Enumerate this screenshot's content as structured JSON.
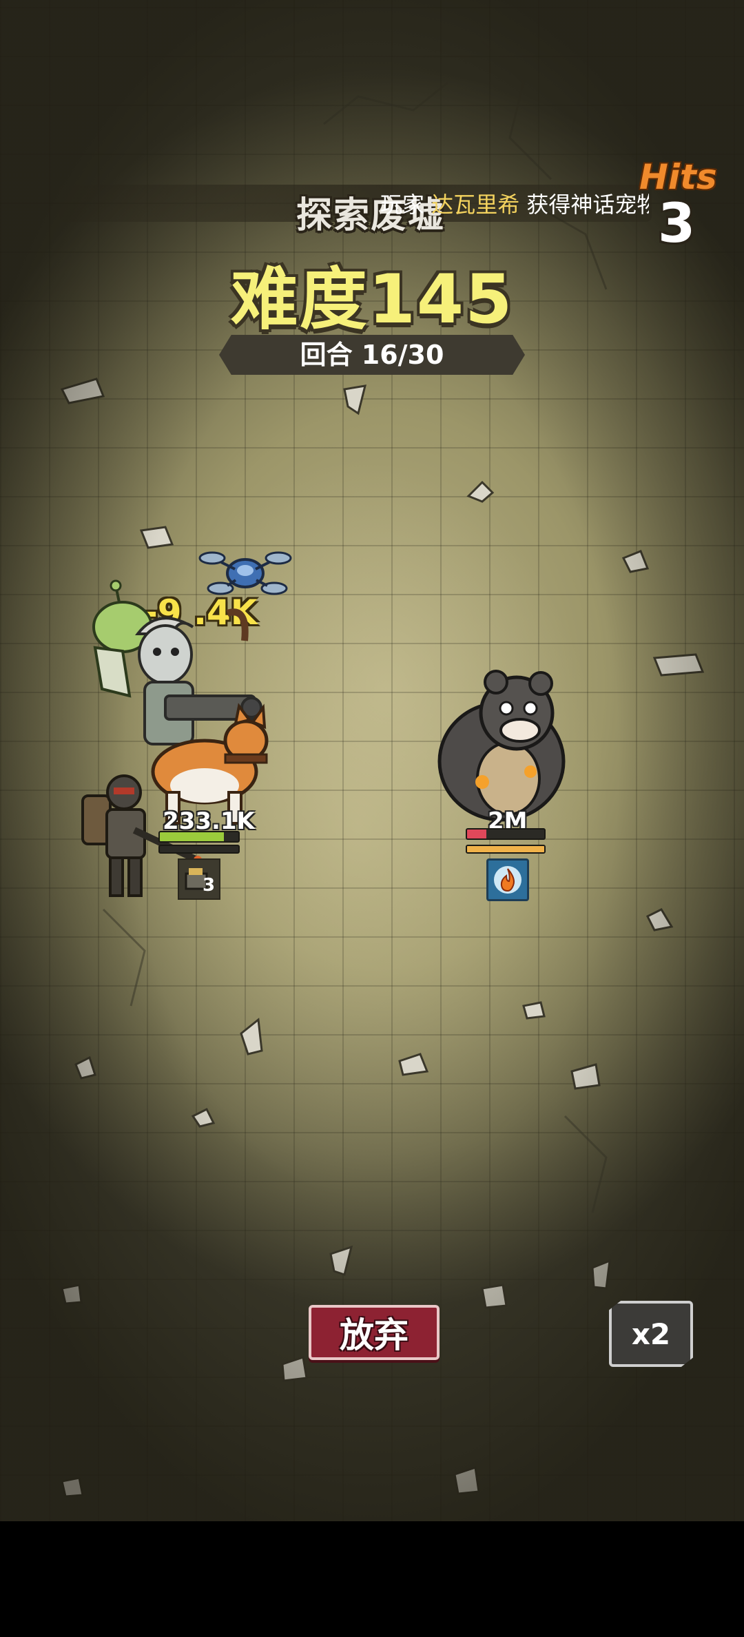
{
  "header": {
    "stage_name": "探索废墟",
    "marquee": {
      "prefix": "玩家",
      "player_name": "达瓦里希",
      "suffix": "获得神话宠物"
    },
    "hits_label": "Hits",
    "hits_count": "3"
  },
  "difficulty_title": "难度145",
  "round_label": "回合 16/30",
  "combat": {
    "damage_popup": "-9 .4K",
    "player_team": {
      "hp_value": "233.1K",
      "hp_fraction": 0.82,
      "skill_level": "3"
    },
    "enemy": {
      "hp_value": "2M",
      "hp_fraction": 0.25,
      "shield_fraction": 1.0,
      "status_icon": "fire-icon"
    }
  },
  "controls": {
    "give_up_label": "放弃",
    "speed_label": "x2"
  },
  "colors": {
    "difficulty_text": "#f6f07a",
    "hits_label": "#f08a2c",
    "player_hp_bar": "#9bcb3c",
    "enemy_hp_bar": "#e0485a",
    "enemy_shield_bar": "#f0b24a",
    "give_up_button": "#8d2232"
  }
}
